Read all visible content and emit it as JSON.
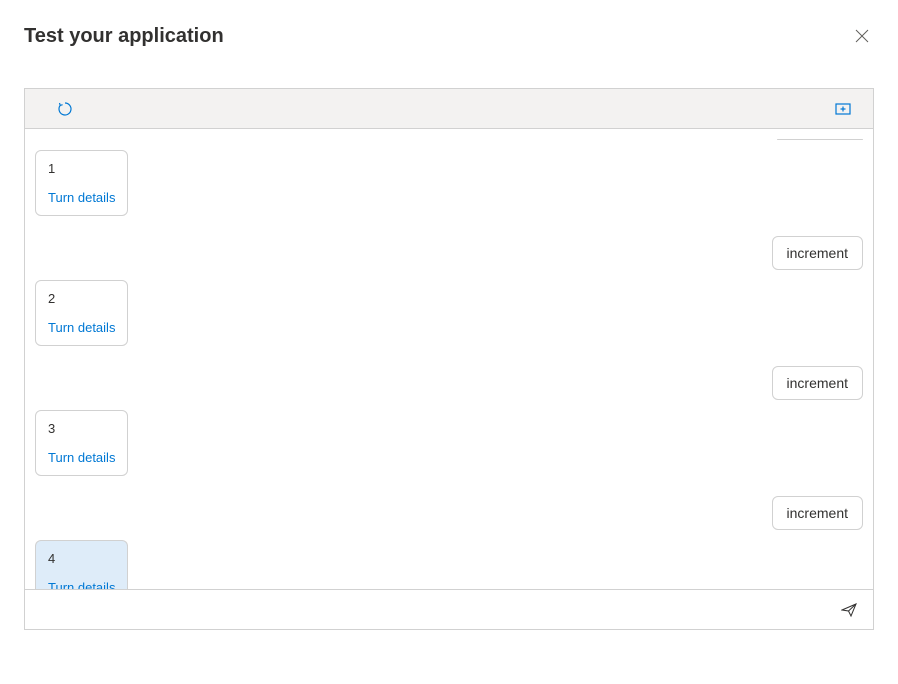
{
  "header": {
    "title": "Test your application"
  },
  "chat": {
    "turn_details_label": "Turn details",
    "messages": [
      {
        "role": "bot",
        "value": "1",
        "highlighted": false
      },
      {
        "role": "user",
        "value": "increment"
      },
      {
        "role": "bot",
        "value": "2",
        "highlighted": false
      },
      {
        "role": "user",
        "value": "increment"
      },
      {
        "role": "bot",
        "value": "3",
        "highlighted": false
      },
      {
        "role": "user",
        "value": "increment"
      },
      {
        "role": "bot",
        "value": "4",
        "highlighted": true
      }
    ]
  },
  "input": {
    "placeholder": "",
    "value": ""
  }
}
